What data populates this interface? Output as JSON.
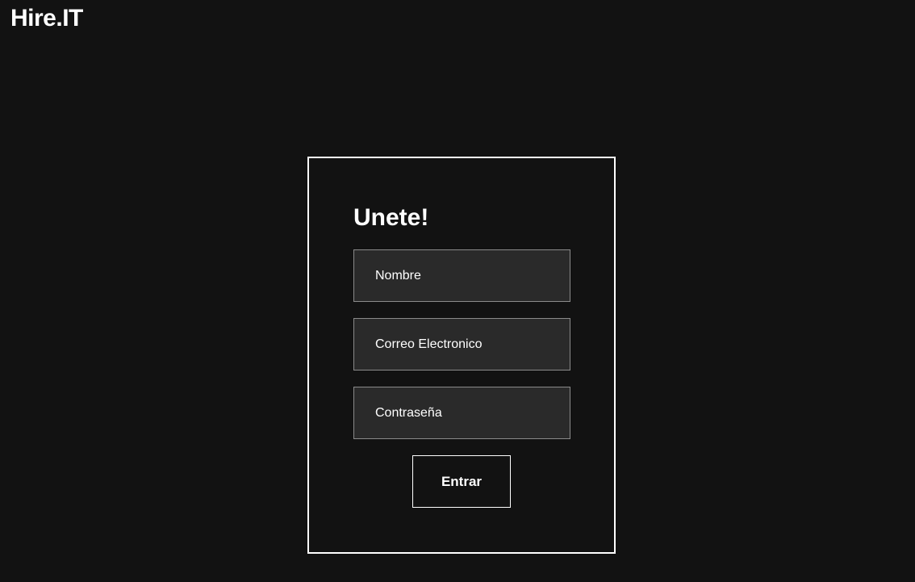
{
  "header": {
    "logo_text": "Hire.IT"
  },
  "signup_form": {
    "title": "Unete!",
    "name_placeholder": "Nombre",
    "email_placeholder": "Correo Electronico",
    "password_placeholder": "Contraseña",
    "submit_label": "Entrar"
  },
  "colors": {
    "background": "#121212",
    "input_background": "#2a2a2a",
    "input_border": "#8a8a8a",
    "text": "#ffffff"
  }
}
